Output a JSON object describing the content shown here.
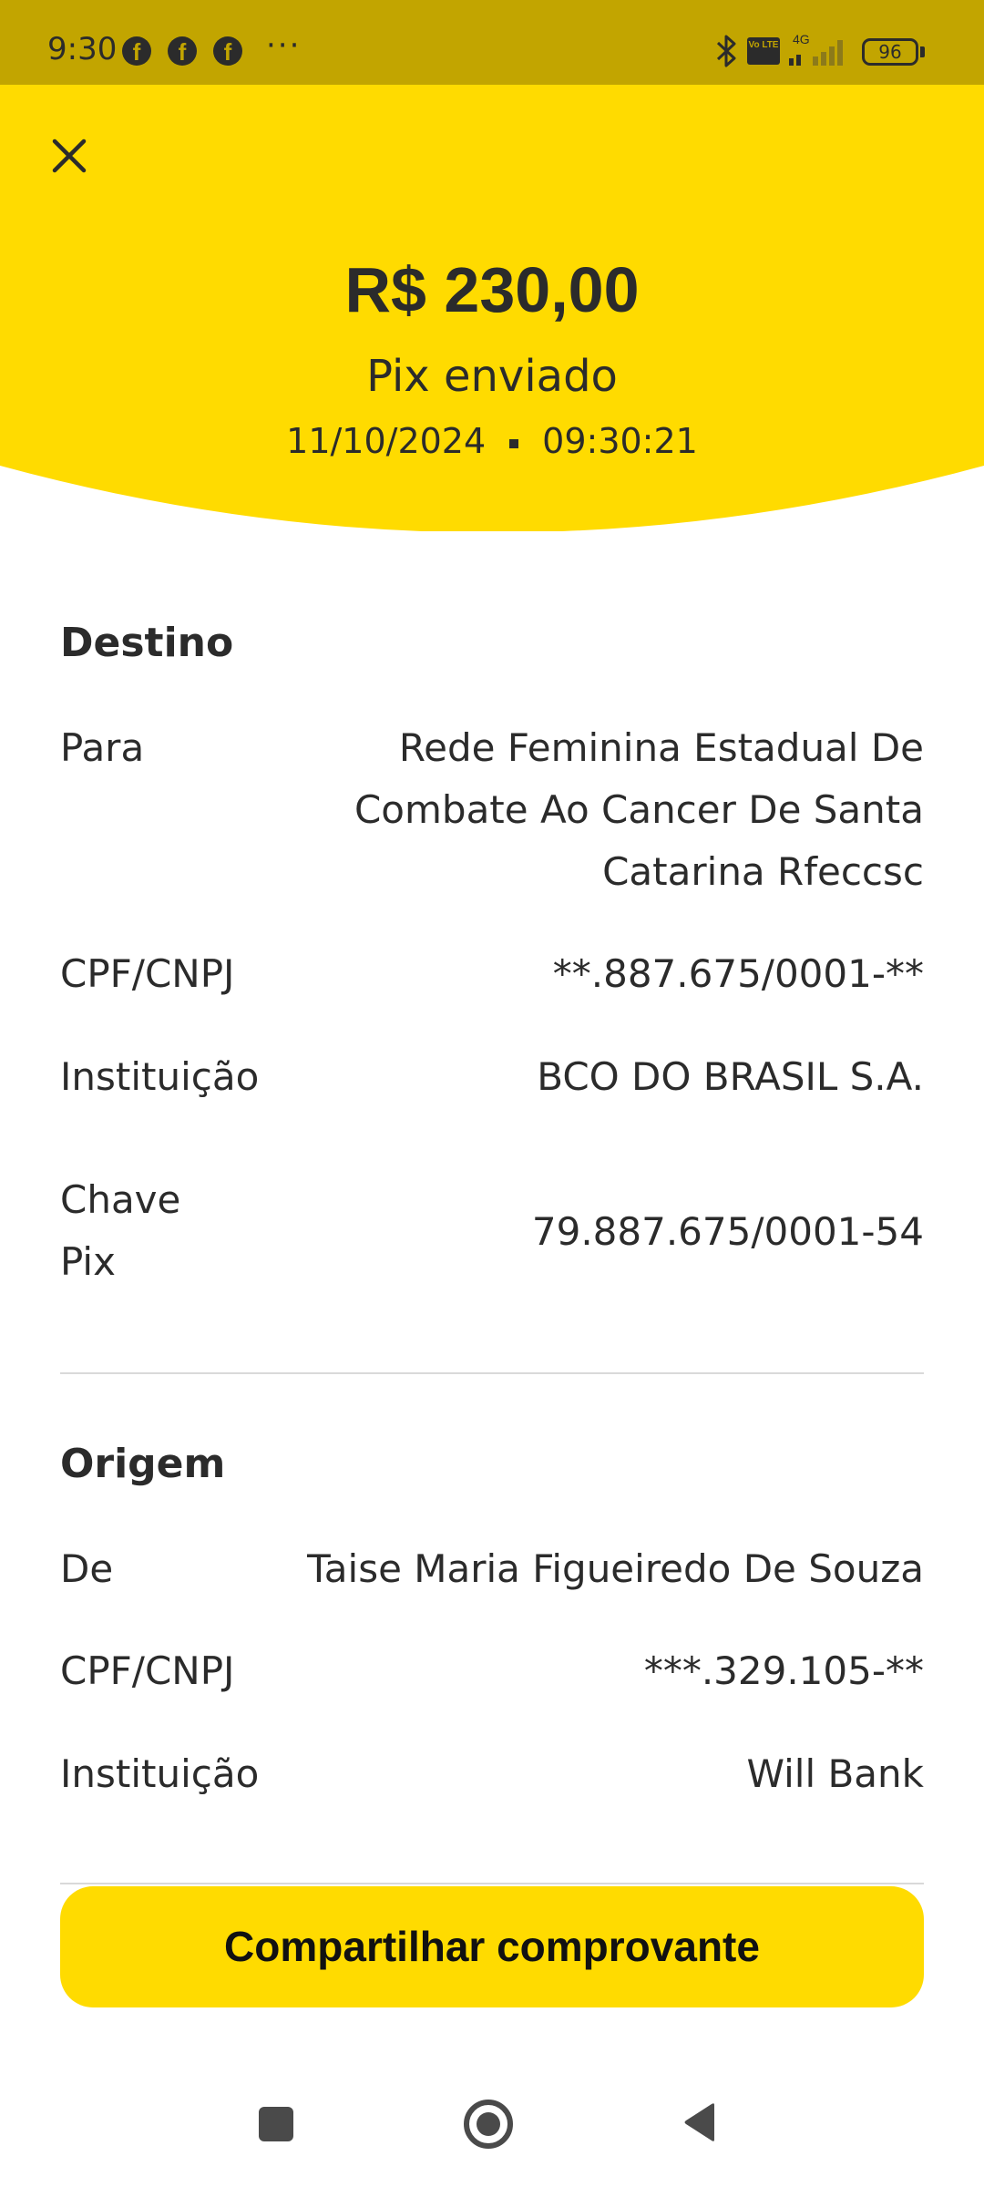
{
  "status_bar": {
    "time": "9:30",
    "dots": "···",
    "volte": "Vo LTE",
    "network": "4G",
    "battery": "96"
  },
  "header": {
    "amount": "R$ 230,00",
    "status": "Pix enviado",
    "date": "11/10/2024",
    "time": "09:30:21"
  },
  "destino": {
    "title": "Destino",
    "rows": [
      {
        "label": "Para",
        "value_lines": [
          "Rede Feminina Estadual De",
          "Combate Ao Cancer De Santa",
          "Catarina Rfeccsc"
        ]
      },
      {
        "label": "CPF/CNPJ",
        "value": "**.887.675/0001-**"
      },
      {
        "label": "Instituição",
        "value": "BCO DO BRASIL S.A."
      },
      {
        "label_lines": [
          "Chave",
          "Pix"
        ],
        "value": "79.887.675/0001-54"
      }
    ]
  },
  "origem": {
    "title": "Origem",
    "rows": [
      {
        "label": "De",
        "value": "Taise Maria Figueiredo De Souza"
      },
      {
        "label": "CPF/CNPJ",
        "value": "***.329.105-**"
      },
      {
        "label": "Instituição",
        "value": "Will Bank"
      }
    ]
  },
  "share_button": {
    "label": "Compartilhar comprovante"
  },
  "colors": {
    "brand_yellow": "#ffdb00",
    "status_bar": "#c2a500",
    "text": "#2b2b2b"
  }
}
